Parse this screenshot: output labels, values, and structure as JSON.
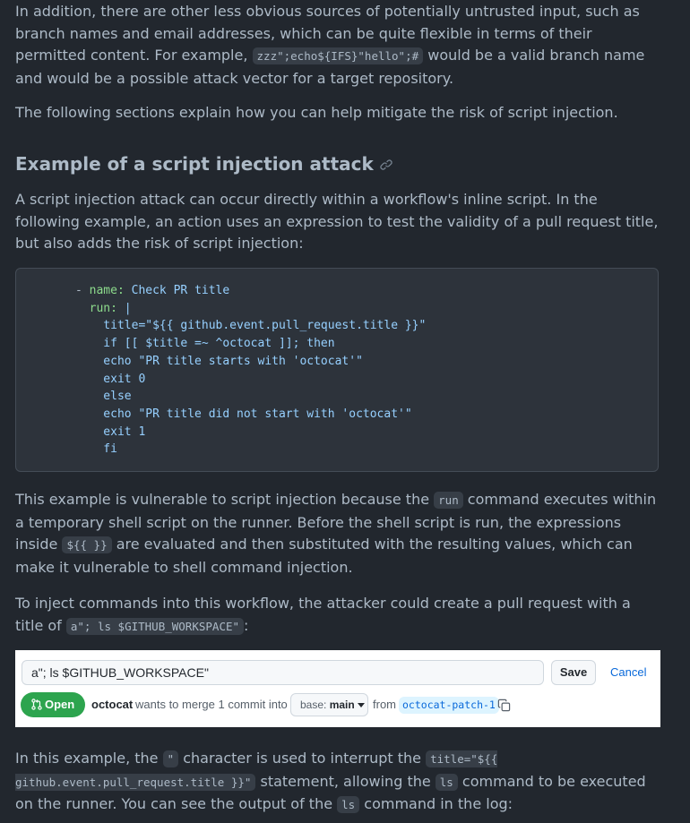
{
  "para1": {
    "before": "In addition, there are other less obvious sources of potentially untrusted input, such as branch names and email addresses, which can be quite flexible in terms of their permitted content. For example, ",
    "code": "zzz\";echo${IFS}\"hello\";#",
    "after": " would be a valid branch name and would be a possible attack vector for a target repository."
  },
  "para2": "The following sections explain how you can help mitigate the risk of script injection.",
  "heading": "Example of a script injection attack",
  "para3": "A script injection attack can occur directly within a workflow's inline script. In the following example, an action uses an expression to test the validity of a pull request title, but also adds the risk of script injection:",
  "code_block": {
    "line1_dash": "- ",
    "line1_key": "name:",
    "line1_val": " Check PR title",
    "line2_key": "  run:",
    "line2_val": " |",
    "lines": [
      "    title=\"${{ github.event.pull_request.title }}\"",
      "    if [[ $title =~ ^octocat ]]; then",
      "    echo \"PR title starts with 'octocat'\"",
      "    exit 0",
      "    else",
      "    echo \"PR title did not start with 'octocat'\"",
      "    exit 1",
      "    fi"
    ]
  },
  "para4": {
    "t1": "This example is vulnerable to script injection because the ",
    "c1": "run",
    "t2": " command executes within a temporary shell script on the runner. Before the shell script is run, the expressions inside ",
    "c2": "${{ }}",
    "t3": " are evaluated and then substituted with the resulting values, which can make it vulnerable to shell command injection."
  },
  "para5": {
    "t1": "To inject commands into this workflow, the attacker could create a pull request with a title of ",
    "c1": "a\"; ls $GITHUB_WORKSPACE\"",
    "t2": ":"
  },
  "pr": {
    "title_value": "a\"; ls $GITHUB_WORKSPACE\"",
    "save_label": "Save",
    "cancel_label": "Cancel",
    "status": "Open",
    "author": "octocat",
    "merge_text": "wants to merge 1 commit into",
    "base_prefix": "base: ",
    "base_branch": "main",
    "from_text": "from",
    "head_branch": "octocat-patch-1"
  },
  "para6": {
    "t1": "In this example, the ",
    "c1": "\"",
    "t2": " character is used to interrupt the ",
    "c2": "title=\"${{ github.event.pull_request.title }}\"",
    "t3": " statement, allowing the ",
    "c3": "ls",
    "t4": " command to be executed on the runner. You can see the output of the ",
    "c4": "ls",
    "t5": " command in the log:"
  },
  "colors": {
    "background": "#22272e",
    "text": "#adbac7",
    "open_badge": "#2da44e",
    "link": "#0969da"
  }
}
